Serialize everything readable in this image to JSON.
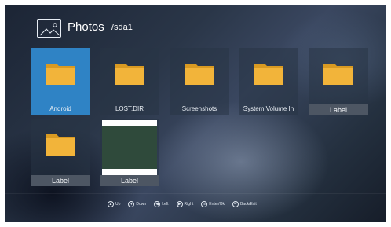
{
  "header": {
    "title": "Photos",
    "path": "/sda1",
    "icon": "photo-icon"
  },
  "tiles": [
    {
      "label": "Android",
      "type": "folder",
      "selected": true
    },
    {
      "label": "LOST.DIR",
      "type": "folder",
      "selected": false
    },
    {
      "label": "Screenshots",
      "type": "folder",
      "selected": false
    },
    {
      "label": "System Volume In",
      "type": "folder",
      "selected": false
    },
    {
      "label": "Label",
      "type": "folder",
      "selected": false
    },
    {
      "label": "Label",
      "type": "folder",
      "selected": false
    },
    {
      "label": "Label",
      "type": "image",
      "selected": false
    }
  ],
  "footer": {
    "hints": [
      {
        "icon": "up-icon",
        "glyph": "▲",
        "label": "Up"
      },
      {
        "icon": "down-icon",
        "glyph": "▼",
        "label": "Down"
      },
      {
        "icon": "left-icon",
        "glyph": "◀",
        "label": "Left"
      },
      {
        "icon": "right-icon",
        "glyph": "▶",
        "label": "Right"
      },
      {
        "icon": "ok-icon",
        "glyph": "OK",
        "label": "Enter/Ok"
      },
      {
        "icon": "back-icon",
        "glyph": "↶",
        "label": "Back/Exit"
      }
    ]
  },
  "colors": {
    "selected_tile": "#2f83c5",
    "folder": "#f2b43a"
  }
}
